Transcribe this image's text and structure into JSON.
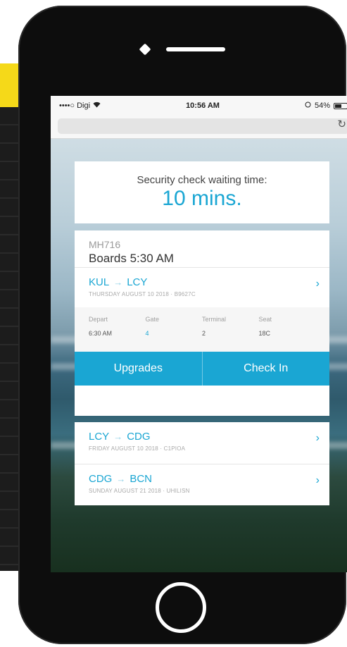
{
  "statusbar": {
    "carrier": "••••○ Digi",
    "wifi_icon": "wifi-icon",
    "time": "10:56 AM",
    "battery": "54%"
  },
  "security": {
    "label": "Security check waiting time:",
    "value": "10 mins."
  },
  "current_flight": {
    "number": "MH716",
    "boards": "Boards 5:30 AM",
    "from": "KUL",
    "to": "LCY",
    "subtitle": "THURSDAY AUGUST 10 2018 · B9627C",
    "details": [
      {
        "label": "Depart",
        "value": "6:30 AM"
      },
      {
        "label": "Gate",
        "value": "4"
      },
      {
        "label": "Terminal",
        "value": "2"
      },
      {
        "label": "Seat",
        "value": "18C"
      }
    ],
    "upgrades_label": "Upgrades",
    "checkin_label": "Check In"
  },
  "upcoming": [
    {
      "from": "LCY",
      "to": "CDG",
      "subtitle": "FRIDAY AUGUST 10 2018 · C1PIOA"
    },
    {
      "from": "CDG",
      "to": "BCN",
      "subtitle": "SUNDAY AUGUST 21 2018 · UHILISN"
    }
  ],
  "colors": {
    "accent": "#1aa6d3",
    "poster_yellow": "#f5d919"
  }
}
